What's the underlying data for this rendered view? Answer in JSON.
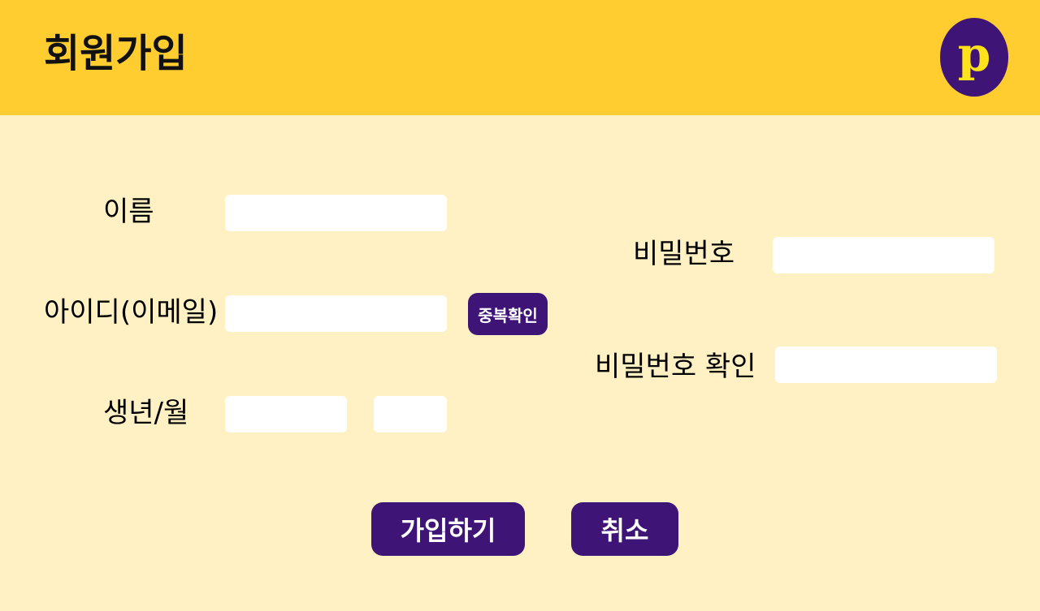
{
  "header": {
    "title": "회원가입",
    "logo_letter": "p",
    "background_color": "#FFCD2F",
    "logo_color": "#3F1477",
    "logo_letter_color": "#FFE21A"
  },
  "form": {
    "name_label": "이름",
    "id_label": "아이디(이메일)",
    "birth_label": "생년/월",
    "password_label": "비밀번호",
    "password_confirm_label": "비밀번호 확인",
    "duplicate_check_label": "중복확인",
    "name_value": "",
    "id_value": "",
    "birth_year_value": "",
    "birth_month_value": "",
    "password_value": "",
    "password_confirm_value": ""
  },
  "actions": {
    "submit_label": "가입하기",
    "cancel_label": "취소"
  },
  "colors": {
    "page_background": "#FFF1C3",
    "button": "#3F1477",
    "button_text": "#FFFFFF"
  }
}
